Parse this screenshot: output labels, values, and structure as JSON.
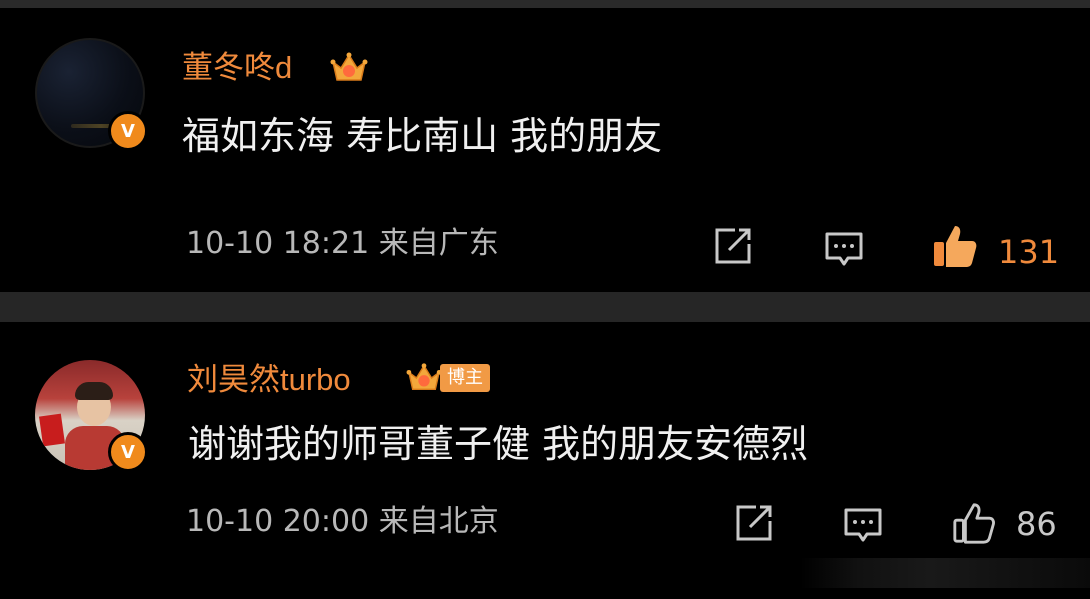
{
  "colors": {
    "background": "#000000",
    "divider": "#262626",
    "username": "#f08a3c",
    "verified_badge": "#f08a1c",
    "body_text": "#f0f0f0",
    "meta_text": "#b8b8b8",
    "liked": "#f08a3c"
  },
  "comments": [
    {
      "username": "董冬咚d",
      "level_icon": "crown-icon",
      "text": "福如东海 寿比南山 我的朋友",
      "meta": "10-10 18:21 来自广东",
      "actions": {
        "share_icon": "share-icon",
        "reply_icon": "comment-icon",
        "like_icon": "thumbs-up-icon",
        "liked": true,
        "like_count": "131"
      }
    },
    {
      "username": "刘昊然turbo",
      "level_icon": "crown-icon",
      "badge": "博主",
      "text": "谢谢我的师哥董子健 我的朋友安德烈",
      "meta": "10-10 20:00 来自北京",
      "actions": {
        "share_icon": "share-icon",
        "reply_icon": "comment-icon",
        "like_icon": "thumbs-up-icon",
        "liked": false,
        "like_count": "86"
      }
    }
  ]
}
